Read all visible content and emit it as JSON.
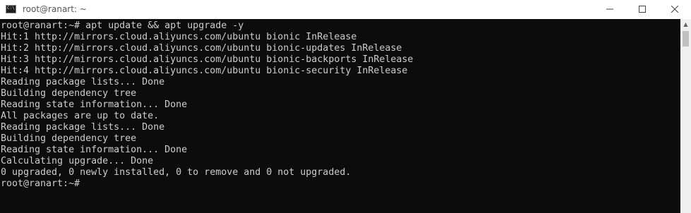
{
  "window": {
    "title": "root@ranart: ~",
    "icon_text": "C:\\",
    "controls": {
      "minimize": "—",
      "maximize": "☐",
      "close": "✕"
    }
  },
  "terminal": {
    "lines": [
      "root@ranart:~# apt update && apt upgrade -y",
      "Hit:1 http://mirrors.cloud.aliyuncs.com/ubuntu bionic InRelease",
      "Hit:2 http://mirrors.cloud.aliyuncs.com/ubuntu bionic-updates InRelease",
      "Hit:3 http://mirrors.cloud.aliyuncs.com/ubuntu bionic-backports InRelease",
      "Hit:4 http://mirrors.cloud.aliyuncs.com/ubuntu bionic-security InRelease",
      "Reading package lists... Done",
      "Building dependency tree",
      "Reading state information... Done",
      "All packages are up to date.",
      "Reading package lists... Done",
      "Building dependency tree",
      "Reading state information... Done",
      "Calculating upgrade... Done",
      "0 upgraded, 0 newly installed, 0 to remove and 0 not upgraded.",
      "root@ranart:~#"
    ],
    "background": "#0c0c0c",
    "foreground": "#cccccc"
  },
  "icons": {
    "app": "terminal-icon",
    "minimize": "minimize-icon",
    "maximize": "maximize-icon",
    "close": "close-icon",
    "scroll_up": "scroll-up-arrow-icon"
  }
}
